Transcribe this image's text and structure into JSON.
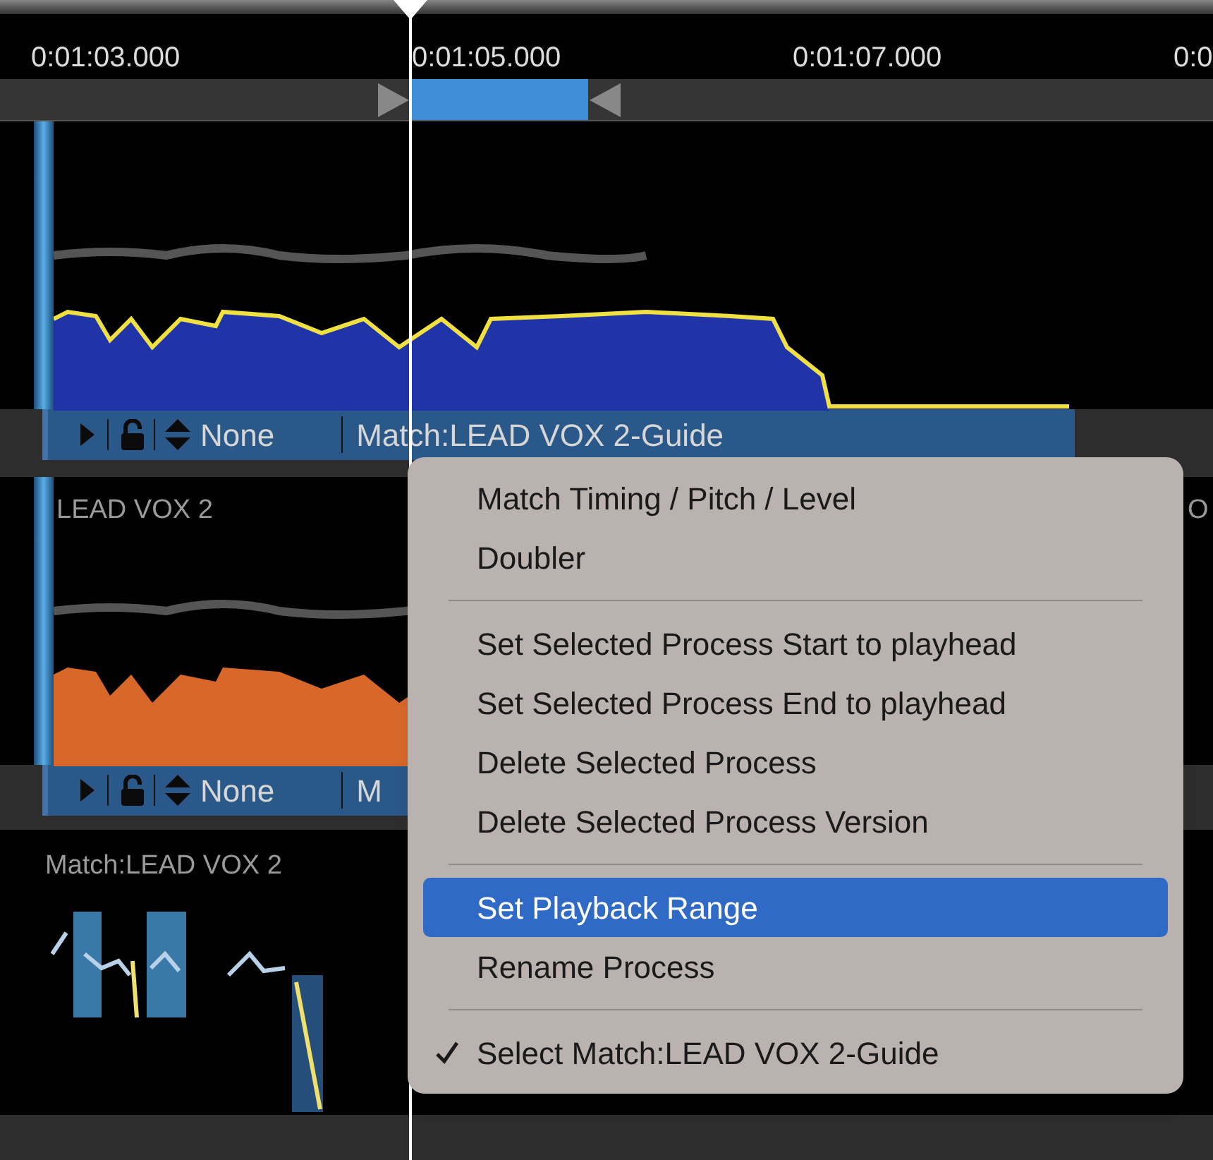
{
  "timeline": {
    "ticks": [
      "0:01:03.000",
      "0:01:05.000",
      "0:01:07.000",
      "0:0"
    ]
  },
  "tracks": [
    {
      "kind": "vocal",
      "color": "#2034a8",
      "header": {
        "preset": "None",
        "process": "Match:LEAD VOX 2-Guide"
      }
    },
    {
      "kind": "vocal",
      "label": "LEAD VOX 2",
      "right_label": "O",
      "color": "#d8682a",
      "header": {
        "preset": "None",
        "process": "M"
      }
    },
    {
      "kind": "match",
      "label": "Match:LEAD VOX 2"
    }
  ],
  "menu": {
    "items": [
      {
        "kind": "item",
        "label": "Match Timing / Pitch / Level",
        "selected": false,
        "checked": false
      },
      {
        "kind": "item",
        "label": "Doubler",
        "selected": false,
        "checked": false
      },
      {
        "kind": "separator"
      },
      {
        "kind": "item",
        "label": "Set Selected Process Start to playhead",
        "selected": false,
        "checked": false
      },
      {
        "kind": "item",
        "label": "Set Selected Process End to playhead",
        "selected": false,
        "checked": false
      },
      {
        "kind": "item",
        "label": "Delete Selected Process",
        "selected": false,
        "checked": false
      },
      {
        "kind": "item",
        "label": "Delete Selected Process Version",
        "selected": false,
        "checked": false
      },
      {
        "kind": "separator"
      },
      {
        "kind": "item",
        "label": "Set Playback Range",
        "selected": true,
        "checked": false
      },
      {
        "kind": "item",
        "label": "Rename Process",
        "selected": false,
        "checked": false
      },
      {
        "kind": "separator"
      },
      {
        "kind": "item",
        "label": "Select Match:LEAD VOX 2-Guide",
        "selected": false,
        "checked": true
      }
    ]
  }
}
